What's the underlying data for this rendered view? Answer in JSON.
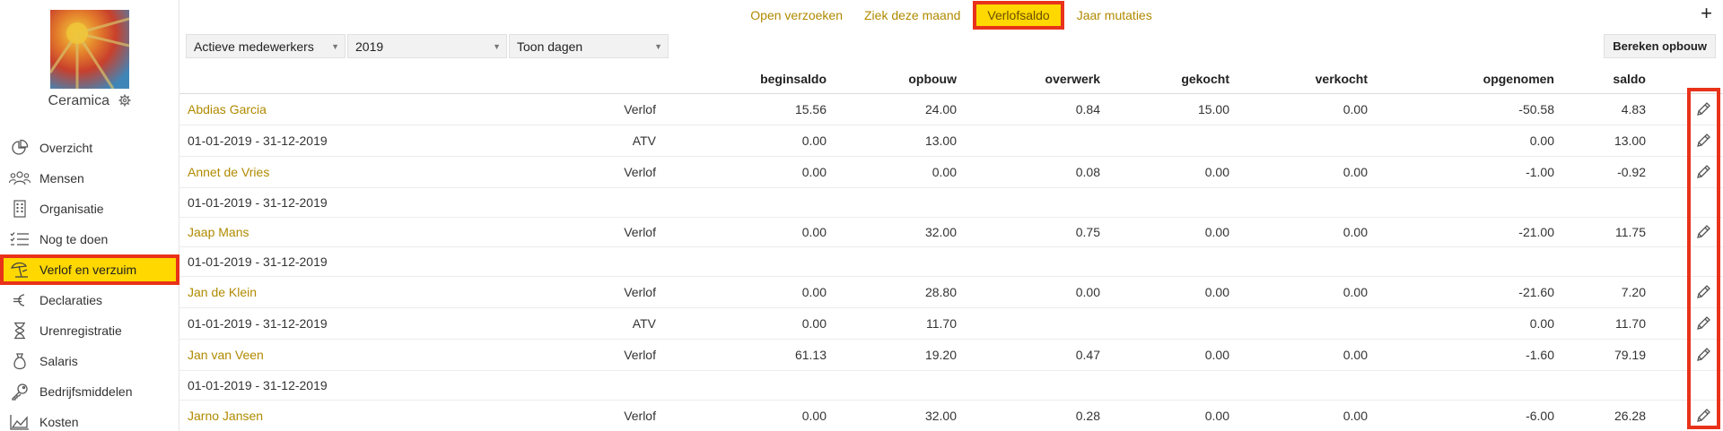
{
  "company": {
    "name": "Ceramica"
  },
  "sidebar": {
    "items": [
      {
        "label": "Overzicht",
        "icon": "pie-chart-icon",
        "active": false
      },
      {
        "label": "Mensen",
        "icon": "people-icon",
        "active": false
      },
      {
        "label": "Organisatie",
        "icon": "building-icon",
        "active": false
      },
      {
        "label": "Nog te doen",
        "icon": "checklist-icon",
        "active": false
      },
      {
        "label": "Verlof en verzuim",
        "icon": "beach-umbrella-icon",
        "active": true
      },
      {
        "label": "Declaraties",
        "icon": "euro-icon",
        "active": false
      },
      {
        "label": "Urenregistratie",
        "icon": "hourglass-icon",
        "active": false
      },
      {
        "label": "Salaris",
        "icon": "money-bag-icon",
        "active": false
      },
      {
        "label": "Bedrijfsmiddelen",
        "icon": "key-icon",
        "active": false
      },
      {
        "label": "Kosten",
        "icon": "area-chart-icon",
        "active": false
      }
    ]
  },
  "topnav": {
    "links": [
      {
        "label": "Open verzoeken",
        "active": false
      },
      {
        "label": "Ziek deze maand",
        "active": false
      },
      {
        "label": "Verlofsaldo",
        "active": true
      },
      {
        "label": "Jaar mutaties",
        "active": false
      }
    ],
    "plus_label": "+"
  },
  "filters": {
    "employees": "Actieve medewerkers",
    "year": "2019",
    "unit": "Toon dagen",
    "calc_button": "Bereken opbouw"
  },
  "table": {
    "headers": {
      "beginsaldo": "beginsaldo",
      "opbouw": "opbouw",
      "overwerk": "overwerk",
      "gekocht": "gekocht",
      "verkocht": "verkocht",
      "opgenomen": "opgenomen",
      "saldo": "saldo"
    },
    "rows": [
      {
        "kind": "employee",
        "label": "Abdias Garcia",
        "type": "Verlof",
        "beginsaldo": "15.56",
        "opbouw": "24.00",
        "overwerk": "0.84",
        "gekocht": "15.00",
        "verkocht": "0.00",
        "opgenomen": "-50.58",
        "saldo": "4.83",
        "edit": true
      },
      {
        "kind": "period",
        "label": "01-01-2019 - 31-12-2019",
        "type": "ATV",
        "beginsaldo": "0.00",
        "opbouw": "13.00",
        "overwerk": "",
        "gekocht": "",
        "verkocht": "",
        "opgenomen": "0.00",
        "saldo": "13.00",
        "edit": true
      },
      {
        "kind": "employee",
        "label": "Annet de Vries",
        "type": "Verlof",
        "beginsaldo": "0.00",
        "opbouw": "0.00",
        "overwerk": "0.08",
        "gekocht": "0.00",
        "verkocht": "0.00",
        "opgenomen": "-1.00",
        "saldo": "-0.92",
        "edit": true
      },
      {
        "kind": "period",
        "label": "01-01-2019 - 31-12-2019",
        "type": "",
        "beginsaldo": "",
        "opbouw": "",
        "overwerk": "",
        "gekocht": "",
        "verkocht": "",
        "opgenomen": "",
        "saldo": "",
        "edit": false
      },
      {
        "kind": "employee",
        "label": "Jaap Mans",
        "type": "Verlof",
        "beginsaldo": "0.00",
        "opbouw": "32.00",
        "overwerk": "0.75",
        "gekocht": "0.00",
        "verkocht": "0.00",
        "opgenomen": "-21.00",
        "saldo": "11.75",
        "edit": true
      },
      {
        "kind": "period",
        "label": "01-01-2019 - 31-12-2019",
        "type": "",
        "beginsaldo": "",
        "opbouw": "",
        "overwerk": "",
        "gekocht": "",
        "verkocht": "",
        "opgenomen": "",
        "saldo": "",
        "edit": false
      },
      {
        "kind": "employee",
        "label": "Jan de Klein",
        "type": "Verlof",
        "beginsaldo": "0.00",
        "opbouw": "28.80",
        "overwerk": "0.00",
        "gekocht": "0.00",
        "verkocht": "0.00",
        "opgenomen": "-21.60",
        "saldo": "7.20",
        "edit": true
      },
      {
        "kind": "period",
        "label": "01-01-2019 - 31-12-2019",
        "type": "ATV",
        "beginsaldo": "0.00",
        "opbouw": "11.70",
        "overwerk": "",
        "gekocht": "",
        "verkocht": "",
        "opgenomen": "0.00",
        "saldo": "11.70",
        "edit": true
      },
      {
        "kind": "employee",
        "label": "Jan van Veen",
        "type": "Verlof",
        "beginsaldo": "61.13",
        "opbouw": "19.20",
        "overwerk": "0.47",
        "gekocht": "0.00",
        "verkocht": "0.00",
        "opgenomen": "-1.60",
        "saldo": "79.19",
        "edit": true
      },
      {
        "kind": "period",
        "label": "01-01-2019 - 31-12-2019",
        "type": "",
        "beginsaldo": "",
        "opbouw": "",
        "overwerk": "",
        "gekocht": "",
        "verkocht": "",
        "opgenomen": "",
        "saldo": "",
        "edit": false
      },
      {
        "kind": "employee",
        "label": "Jarno Jansen",
        "type": "Verlof",
        "beginsaldo": "0.00",
        "opbouw": "32.00",
        "overwerk": "0.28",
        "gekocht": "0.00",
        "verkocht": "0.00",
        "opgenomen": "-6.00",
        "saldo": "26.28",
        "edit": true
      }
    ]
  },
  "colors": {
    "accent": "#ffd800",
    "link": "#b08a00",
    "highlight": "#e8321a"
  }
}
